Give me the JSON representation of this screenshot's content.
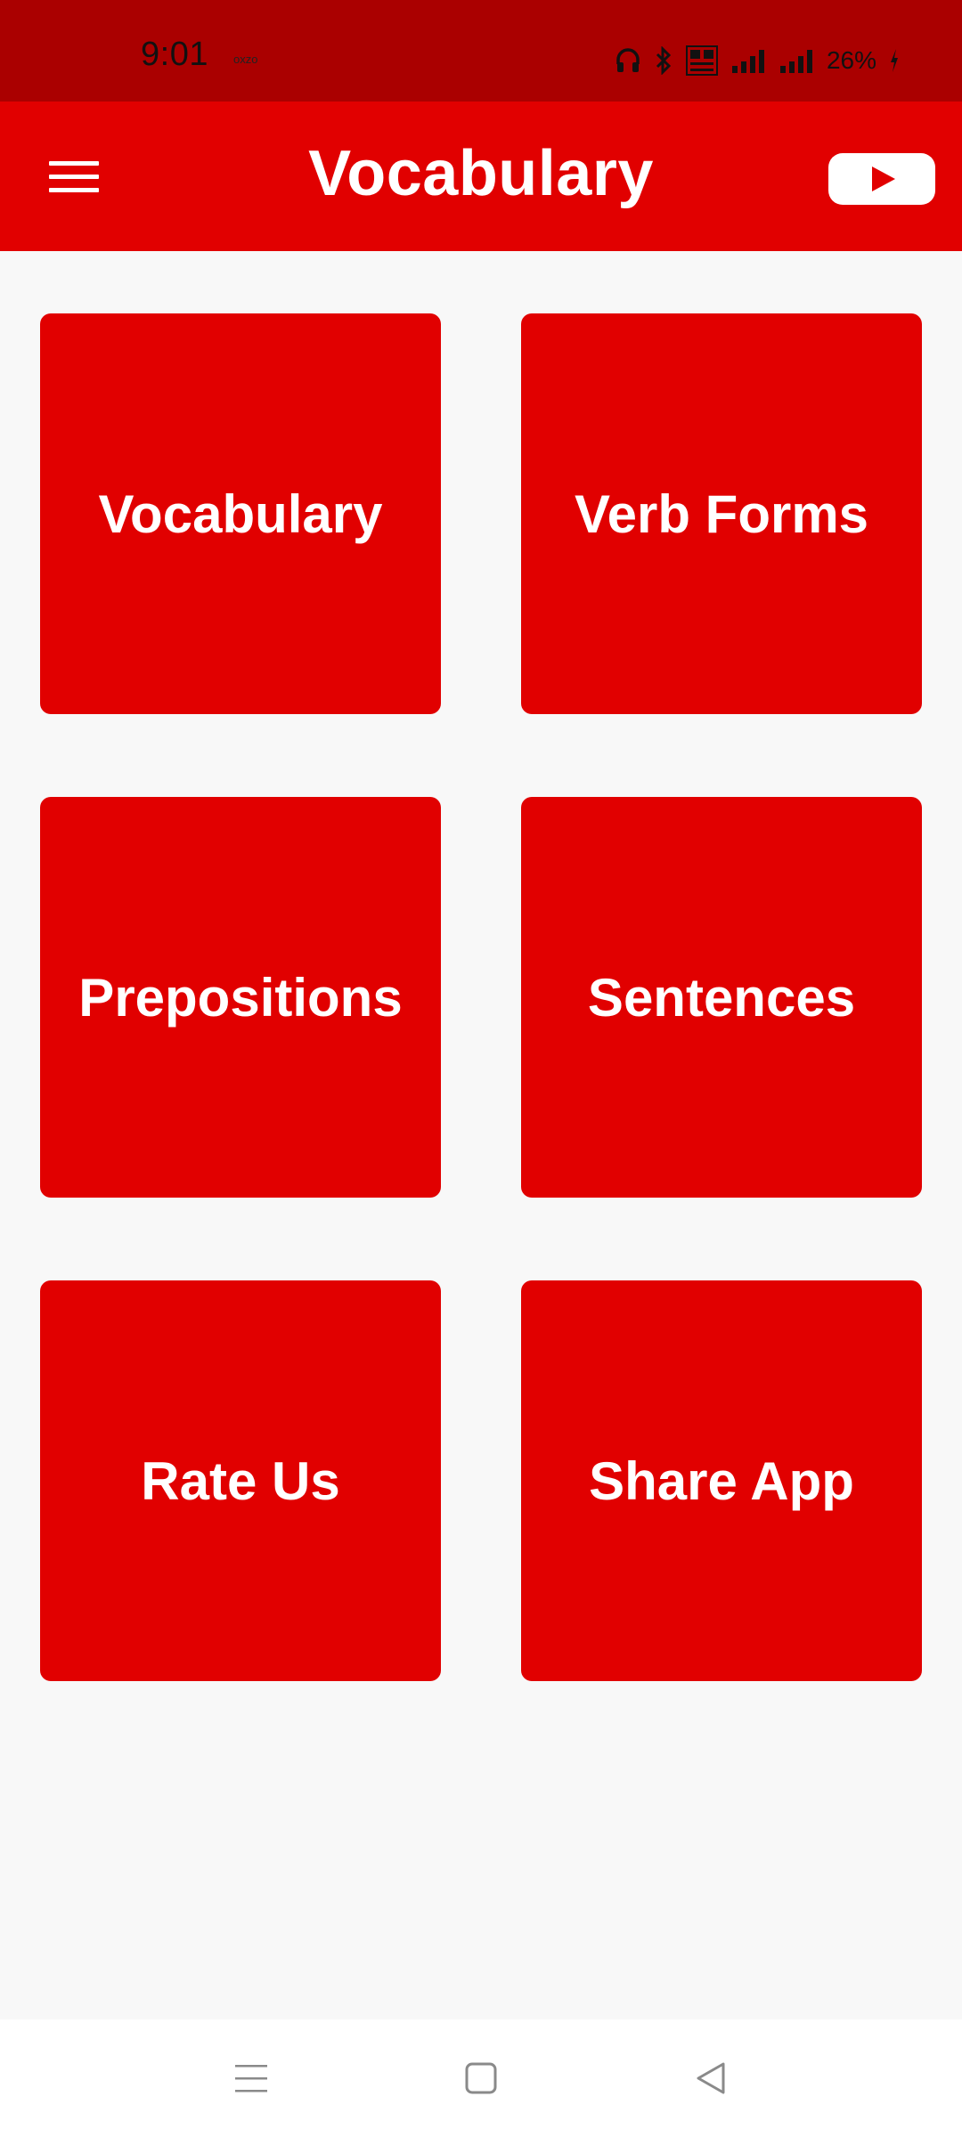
{
  "status_bar": {
    "time": "9:01",
    "small_text": "oxzo",
    "battery": "26%",
    "icons": [
      "headphones-icon",
      "bluetooth-icon",
      "volte-icon",
      "signal-icon",
      "signal-icon",
      "charging-icon"
    ]
  },
  "app_bar": {
    "title": "Vocabulary",
    "menu_icon": "hamburger-menu-icon",
    "action_icon": "youtube-icon"
  },
  "tiles": [
    {
      "label": "Vocabulary"
    },
    {
      "label": "Verb Forms"
    },
    {
      "label": "Prepositions"
    },
    {
      "label": "Sentences"
    },
    {
      "label": "Rate Us"
    },
    {
      "label": "Share App"
    }
  ],
  "nav_bar": {
    "icons": [
      "recent-apps-icon",
      "home-icon",
      "back-icon"
    ]
  },
  "colors": {
    "status_bar": "#aa0000",
    "accent": "#e10000",
    "background": "#f8f8f8",
    "text_on_accent": "#ffffff"
  }
}
